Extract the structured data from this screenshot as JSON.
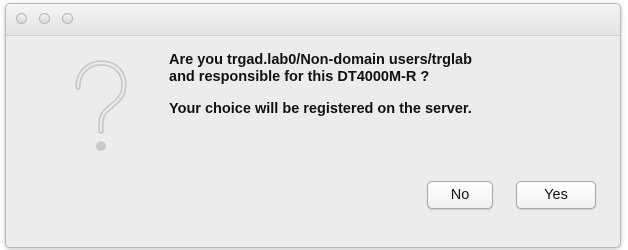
{
  "dialog": {
    "message_line1": "Are you trgad.lab0/Non-domain users/trglab",
    "message_line2": "and responsible for this DT4000M-R ?",
    "message_line3": "Your choice will be registered on the server.",
    "icon": "question-mark-icon"
  },
  "buttons": {
    "no_label": "No",
    "yes_label": "Yes"
  },
  "titlebar": {
    "controls": [
      "close-button",
      "minimize-button",
      "zoom-button"
    ]
  }
}
